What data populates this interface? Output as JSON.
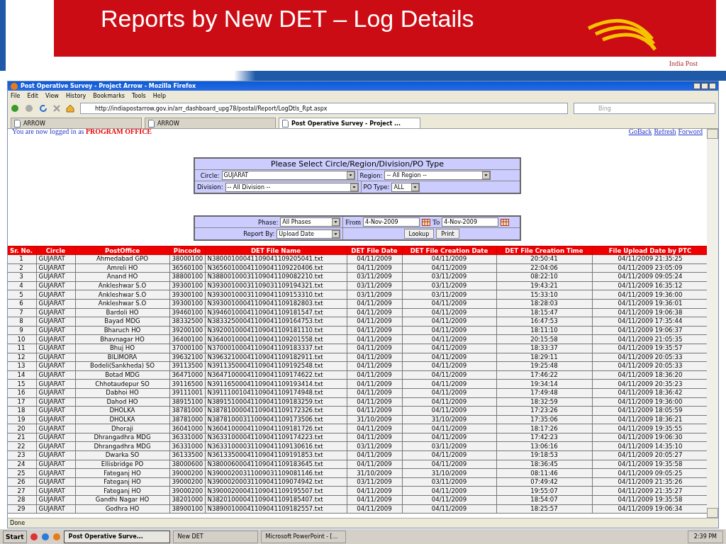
{
  "slide": {
    "title": "Reports by New DET – Log Details",
    "logo_caption": "India Post"
  },
  "browser": {
    "title": "Post Operative Survey - Project Arrow - Mozilla Firefox",
    "menu": [
      "File",
      "Edit",
      "View",
      "History",
      "Bookmarks",
      "Tools",
      "Help"
    ],
    "url": "http://indiapostarrow.gov.in/arr_dashboard_upg78/postal/Report/LogDtls_Rpt.aspx",
    "search_placeholder": "Bing",
    "tabs": [
      {
        "label": "ARROW",
        "selected": false
      },
      {
        "label": "ARROW",
        "selected": false
      },
      {
        "label": "Post Operative Survey - Project ...",
        "selected": true
      }
    ],
    "status": "Done"
  },
  "page": {
    "login_text": "You are now logged in as",
    "login_role": "PROGRAM OFFICE",
    "nav_links": [
      "GoBack",
      "Refresh",
      "Forword"
    ],
    "filter_heading": "Please Select Circle/Region/Division/PO Type",
    "filter_rows": [
      [
        {
          "label": "Circle:",
          "value": "GUJARAT"
        },
        {
          "label": "Region:",
          "value": "-- All Region --"
        }
      ],
      [
        {
          "label": "Division:",
          "value": "-- All Division --"
        },
        {
          "label": "PO Type:",
          "value": "ALL"
        }
      ]
    ],
    "phase": {
      "label": "Phase:",
      "value": "All Phases"
    },
    "from": {
      "label": "From",
      "value": "4-Nov-2009"
    },
    "to": {
      "label": "To",
      "value": "4-Nov-2009"
    },
    "report_by": {
      "label": "Report By:",
      "value": "Upload Date"
    },
    "buttons": [
      "Lookup",
      "Print"
    ],
    "table": {
      "columns": [
        "Sr. No.",
        "Circle",
        "PostOffice",
        "Pincode",
        "DET File Name",
        "DET File Date",
        "DET File Creation Date",
        "DET File Creation Time",
        "File Upload Date by PTC"
      ],
      "rows": [
        [
          "1",
          "GUJARAT",
          "Ahmedabad GPO",
          "38000100",
          "N38000100041109041109205041.txt",
          "04/11/2009",
          "04/11/2009",
          "20:50:41",
          "04/11/2009 21:35:25"
        ],
        [
          "2",
          "GUJARAT",
          "Amreli HO",
          "36560100",
          "N36560100041109041109220406.txt",
          "04/11/2009",
          "04/11/2009",
          "22:04:06",
          "04/11/2009 23:05:09"
        ],
        [
          "3",
          "GUJARAT",
          "Anand HO",
          "38800100",
          "N38800100031109041109082210.txt",
          "03/11/2009",
          "03/11/2009",
          "08:22:10",
          "04/11/2009 09:05:24"
        ],
        [
          "4",
          "GUJARAT",
          "Ankleshwar S.O",
          "39300100",
          "N39300100031109031109194321.txt",
          "03/11/2009",
          "03/11/2009",
          "19:43:21",
          "04/11/2009 16:35:12"
        ],
        [
          "5",
          "GUJARAT",
          "Ankleshwar S.O",
          "39300100",
          "N39300100031109041109153310.txt",
          "03/11/2009",
          "03/11/2009",
          "15:33:10",
          "04/11/2009 19:36:00"
        ],
        [
          "6",
          "GUJARAT",
          "Ankleshwar S.O",
          "39300100",
          "N39300100041109041109182803.txt",
          "04/11/2009",
          "04/11/2009",
          "18:28:03",
          "04/11/2009 19:36:01"
        ],
        [
          "7",
          "GUJARAT",
          "Bardoli HO",
          "39460100",
          "N39460100041109041109181547.txt",
          "04/11/2009",
          "04/11/2009",
          "18:15:47",
          "04/11/2009 19:06:38"
        ],
        [
          "8",
          "GUJARAT",
          "Bayad MDG",
          "38332500",
          "N38332500041109041109164753.txt",
          "04/11/2009",
          "04/11/2009",
          "16:47:53",
          "04/11/2009 17:35:44"
        ],
        [
          "9",
          "GUJARAT",
          "Bharuch HO",
          "39200100",
          "N39200100041109041109181110.txt",
          "04/11/2009",
          "04/11/2009",
          "18:11:10",
          "04/11/2009 19:06:37"
        ],
        [
          "10",
          "GUJARAT",
          "Bhavnagar HO",
          "36400100",
          "N36400100041109041109201558.txt",
          "04/11/2009",
          "04/11/2009",
          "20:15:58",
          "04/11/2009 21:05:35"
        ],
        [
          "11",
          "GUJARAT",
          "Bhuj HO",
          "37000100",
          "N37000100041109041109183337.txt",
          "04/11/2009",
          "04/11/2009",
          "18:33:37",
          "04/11/2009 19:35:57"
        ],
        [
          "12",
          "GUJARAT",
          "BILIMORA",
          "39632100",
          "N39632100041109041109182911.txt",
          "04/11/2009",
          "04/11/2009",
          "18:29:11",
          "04/11/2009 20:05:33"
        ],
        [
          "13",
          "GUJARAT",
          "Bodeli(Sankheda) SO",
          "39113500",
          "N39113500041109041109192548.txt",
          "04/11/2009",
          "04/11/2009",
          "19:25:48",
          "04/11/2009 20:05:33"
        ],
        [
          "14",
          "GUJARAT",
          "Botad MDG",
          "36471000",
          "N36471000041109041109174622.txt",
          "04/11/2009",
          "04/11/2009",
          "17:46:22",
          "04/11/2009 18:36:20"
        ],
        [
          "15",
          "GUJARAT",
          "Chhotaudepur SO",
          "39116500",
          "N39116500041109041109193414.txt",
          "04/11/2009",
          "04/11/2009",
          "19:34:14",
          "04/11/2009 20:35:23"
        ],
        [
          "16",
          "GUJARAT",
          "Dabhoi HO",
          "39111001",
          "N39111001041109041109174948.txt",
          "04/11/2009",
          "04/11/2009",
          "17:49:48",
          "04/11/2009 18:36:42"
        ],
        [
          "17",
          "GUJARAT",
          "Dahod HO",
          "38915100",
          "N38915100041109041109183259.txt",
          "04/11/2009",
          "04/11/2009",
          "18:32:59",
          "04/11/2009 19:36:00"
        ],
        [
          "18",
          "GUJARAT",
          "DHOLKA",
          "38781000",
          "N38781000041109041109172326.txt",
          "04/11/2009",
          "04/11/2009",
          "17:23:26",
          "04/11/2009 18:05:59"
        ],
        [
          "19",
          "GUJARAT",
          "DHOLKA",
          "38781000",
          "N38781000311009041109173506.txt",
          "31/10/2009",
          "31/10/2009",
          "17:35:06",
          "04/11/2009 18:36:21"
        ],
        [
          "20",
          "GUJARAT",
          "Dhoraji",
          "36041000",
          "N36041000041109041109181726.txt",
          "04/11/2009",
          "04/11/2009",
          "18:17:26",
          "04/11/2009 19:35:55"
        ],
        [
          "21",
          "GUJARAT",
          "Dhrangadhra MDG",
          "36331000",
          "N36331000041109041109174223.txt",
          "04/11/2009",
          "04/11/2009",
          "17:42:23",
          "04/11/2009 19:06:30"
        ],
        [
          "22",
          "GUJARAT",
          "Dhrangadhra MDG",
          "36331000",
          "N36331000031109041109130616.txt",
          "03/11/2009",
          "03/11/2009",
          "13:06:16",
          "04/11/2009 14:35:10"
        ],
        [
          "23",
          "GUJARAT",
          "Dwarka SO",
          "36133500",
          "N36133500041109041109191853.txt",
          "04/11/2009",
          "04/11/2009",
          "19:18:53",
          "04/11/2009 20:05:27"
        ],
        [
          "24",
          "GUJARAT",
          "Ellisbridge PO",
          "38000600",
          "N38000600041109041109183645.txt",
          "04/11/2009",
          "04/11/2009",
          "18:36:45",
          "04/11/2009 19:35:58"
        ],
        [
          "25",
          "GUJARAT",
          "Fateganj HO",
          "39000200",
          "N39000200311009031109081146.txt",
          "31/10/2009",
          "31/10/2009",
          "08:11:46",
          "04/11/2009 09:05:25"
        ],
        [
          "26",
          "GUJARAT",
          "Fateganj HO",
          "39000200",
          "N39000200031109041109074942.txt",
          "03/11/2009",
          "03/11/2009",
          "07:49:42",
          "04/11/2009 21:35:26"
        ],
        [
          "27",
          "GUJARAT",
          "Fateganj HO",
          "39000200",
          "N39000200041109041109195507.txt",
          "04/11/2009",
          "04/11/2009",
          "19:55:07",
          "04/11/2009 21:35:27"
        ],
        [
          "28",
          "GUJARAT",
          "Gandhi Nagar HO",
          "38201000",
          "N38201000041109041109185407.txt",
          "04/11/2009",
          "04/11/2009",
          "18:54:07",
          "04/11/2009 19:35:58"
        ],
        [
          "29",
          "GUJARAT",
          "Godhra HO",
          "38900100",
          "N38900100041109041109182557.txt",
          "04/11/2009",
          "04/11/2009",
          "18:25:57",
          "04/11/2009 19:06:34"
        ]
      ]
    }
  },
  "taskbar": {
    "start": "Start",
    "tasks": [
      {
        "label": "Post Operative Surve...",
        "selected": true
      },
      {
        "label": "New DET",
        "selected": false
      },
      {
        "label": "Microsoft PowerPoint - [...",
        "selected": false
      }
    ],
    "clock": "2:39 PM"
  }
}
